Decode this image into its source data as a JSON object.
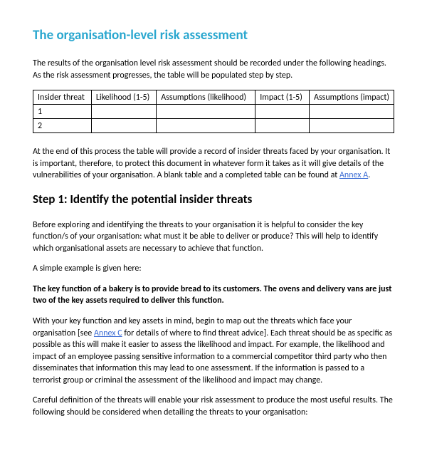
{
  "title": "The organisation-level risk assessment",
  "intro": "The results of the organisation level risk assessment should be recorded under the following headings. As the risk assessment progresses, the table will be populated step by step.",
  "table": {
    "headers": [
      "Insider threat",
      "Likelihood (1-5)",
      "Assumptions (likelihood)",
      "Impact (1-5)",
      "Assumptions (impact)"
    ],
    "rows": [
      [
        "1",
        "",
        "",
        "",
        ""
      ],
      [
        "2",
        "",
        "",
        "",
        ""
      ]
    ]
  },
  "after_table_pre": "At the end of this process the table will provide a record of insider threats faced by your organisation. It is important, therefore, to protect this document in whatever form it takes as it will give details of the vulnerabilities of your organisation. A blank table and a completed table can be found at ",
  "after_table_link": "Annex A",
  "after_table_post": ".",
  "step_heading": "Step 1: Identify the potential insider threats",
  "p1": "Before exploring and identifying the threats to your organisation it is helpful to consider the key function/s of your organisation: what must it be able to deliver or produce? This will help to identify which organisational assets are necessary to achieve that function.",
  "p2": "A simple example is given here:",
  "p3": "The key function of a bakery is to provide bread to its customers. The ovens and delivery vans are just two of the key assets required to deliver this function.",
  "p4_pre": "With your key function and key assets in mind, begin to map out the threats which face your organisation [see ",
  "p4_link": "Annex C",
  "p4_post": " for details of where to find threat advice]. Each threat should be as specific as possible as this will make it easier to assess the likelihood and impact. For example, the likelihood and impact of an employee passing sensitive information to a commercial competitor third party who then disseminates that information this may lead to one assessment. If the information is passed to a terrorist group or criminal the assessment of the likelihood and impact may change.",
  "p5": "Careful definition of the threats will enable your risk assessment to produce the most useful results. The following should be considered when detailing the threats to your organisation:"
}
